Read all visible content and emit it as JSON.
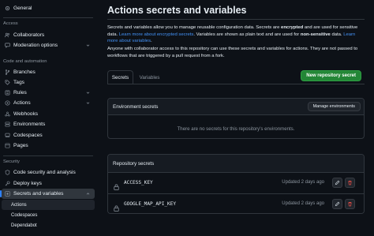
{
  "sidebar": {
    "general": "General",
    "section_access": "Access",
    "collaborators": "Collaborators",
    "moderation": "Moderation options",
    "section_code": "Code and automation",
    "branches": "Branches",
    "tags": "Tags",
    "rules": "Rules",
    "actions": "Actions",
    "webhooks": "Webhooks",
    "environments": "Environments",
    "codespaces": "Codespaces",
    "pages": "Pages",
    "section_security": "Security",
    "code_security": "Code security and analysis",
    "deploy_keys": "Deploy keys",
    "secrets_vars": "Secrets and variables",
    "sub_actions": "Actions",
    "sub_codespaces": "Codespaces",
    "sub_dependabot": "Dependabot"
  },
  "main": {
    "title": "Actions secrets and variables",
    "intro": {
      "p1": "Secrets and variables allow you to manage reusable configuration data. Secrets are ",
      "p1_bold1": "encrypted",
      "p2": " and are used for sensitive data. ",
      "link1": "Learn more about encrypted secrets",
      "p3": ". Variables are shown as plain text and are used for ",
      "p3_bold": "non-sensitive",
      "p4": " data. ",
      "link2": "Learn more about variables",
      "p5": "."
    },
    "fork_note": "Anyone with collaborator access to this repository can use these secrets and variables for actions. They are not passed to workflows that are triggered by a pull request from a fork.",
    "tabs": [
      "Secrets",
      "Variables"
    ],
    "new_secret_button": "New repository secret",
    "env_secrets": {
      "title": "Environment secrets",
      "manage_button": "Manage environments",
      "empty": "There are no secrets for this repository's environments."
    },
    "repo_secrets": {
      "title": "Repository secrets",
      "rows": [
        {
          "name": "ACCESS_KEY",
          "updated": "Updated 2 days ago"
        },
        {
          "name": "GOOGLE_MAP_API_KEY",
          "updated": "Updated 2 days ago"
        }
      ]
    }
  },
  "colors": {
    "background": "#0d1117",
    "border": "#30363d",
    "primary_button": "#238636",
    "link": "#4493f8",
    "danger": "#f85149",
    "active_marker": "#2f81f7"
  }
}
